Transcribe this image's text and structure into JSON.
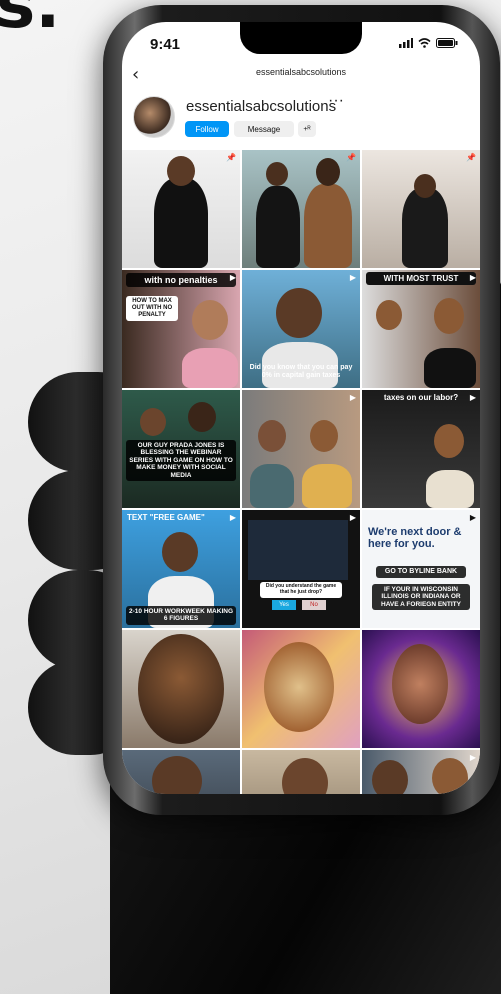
{
  "status": {
    "time": "9:41"
  },
  "nav": {
    "title": "essentialsabcsolutions",
    "back_icon": "chevron-left-icon"
  },
  "profile": {
    "username": "essentialsabcsolutions",
    "more_label": "···",
    "follow_label": "Follow",
    "message_label": "Message",
    "add_user_label": "+ᴿ"
  },
  "colors": {
    "accent": "#0095f6",
    "screen_bg": "#ffffff"
  },
  "grid": {
    "captions": {
      "t4_top": "with no penalties",
      "t4_sub": "HOW TO MAX OUT WITH NO PENALTY",
      "t5": "Did you know that you can pay 0% in capital gain taxes",
      "t6": "WITH MOST TRUST",
      "t7": "OUR GUY PRADA JONES IS BLESSING THE WEBINAR SERIES WITH GAME ON HOW TO MAKE MONEY WITH SOCIAL MEDIA",
      "t9": "taxes on our labor?",
      "t10_top": "TEXT \"FREE GAME\"",
      "t10": "2-10 HOUR WORKWEEK MAKING 6 FIGURES",
      "t11": "Did you understand the game that he just drop?",
      "t11_yes": "Yes",
      "t11_no": "No",
      "t12_title": "We're next door & here for you.",
      "t12_a": "GO TO BYLINE BANK",
      "t12_b": "IF YOUR IN WISCONSIN ILLINOIS OR INDIANA OR HAVE A FORIEGN ENTITY"
    }
  }
}
